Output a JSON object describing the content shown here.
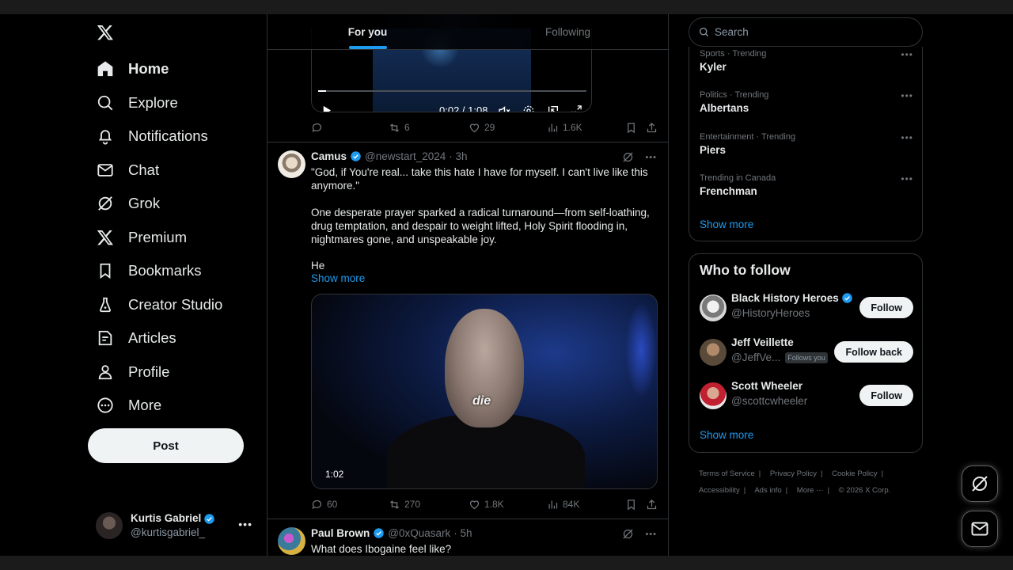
{
  "nav": {
    "items": [
      {
        "label": "Home",
        "icon": "home-icon"
      },
      {
        "label": "Explore",
        "icon": "search-icon"
      },
      {
        "label": "Notifications",
        "icon": "bell-icon"
      },
      {
        "label": "Chat",
        "icon": "mail-icon"
      },
      {
        "label": "Grok",
        "icon": "grok-icon"
      },
      {
        "label": "Premium",
        "icon": "x-icon"
      },
      {
        "label": "Bookmarks",
        "icon": "bookmark-icon"
      },
      {
        "label": "Creator Studio",
        "icon": "flask-icon"
      },
      {
        "label": "Articles",
        "icon": "article-icon"
      },
      {
        "label": "Profile",
        "icon": "person-icon"
      },
      {
        "label": "More",
        "icon": "more-circle-icon"
      }
    ],
    "post_label": "Post",
    "account": {
      "name": "Kurtis Gabriel",
      "handle": "@kurtisgabriel_"
    }
  },
  "tabs": [
    {
      "label": "For you",
      "active": true
    },
    {
      "label": "Following",
      "active": false
    }
  ],
  "video1": {
    "time": "0:02 / 1:08",
    "progress": 0.03
  },
  "post0_actions": {
    "replies": "",
    "reposts": "6",
    "likes": "29",
    "views": "1.6K"
  },
  "post1": {
    "name": "Camus",
    "handle": "@newstart_2024",
    "time": "· 3h",
    "text_p1": "\"God, if You're real... take this hate I have for myself. I can't live like this anymore.\"",
    "text_p2": "One desperate prayer sparked a radical turnaround—from self-loathing, drug temptation, and despair to weight lifted, Holy Spirit flooding in, nightmares gone, and unspeakable joy.",
    "text_p3": "He",
    "show_more": "Show more",
    "video_caption": "die",
    "video_duration": "1:02",
    "actions": {
      "replies": "60",
      "reposts": "270",
      "likes": "1.8K",
      "views": "84K"
    }
  },
  "post2": {
    "name": "Paul Brown",
    "handle": "@0xQuasark",
    "time": "· 5h",
    "text": "What does Ibogaine feel like?"
  },
  "search": {
    "placeholder": "Search"
  },
  "trends": [
    {
      "context": "Sports · Trending",
      "title": "Kyler"
    },
    {
      "context": "Politics · Trending",
      "title": "Albertans"
    },
    {
      "context": "Entertainment · Trending",
      "title": "Piers"
    },
    {
      "context": "Trending in Canada",
      "title": "Frenchman"
    }
  ],
  "trends_show_more": "Show more",
  "who_to_follow": {
    "title": "Who to follow",
    "accounts": [
      {
        "name": "Black History Heroes",
        "handle": "@HistoryHeroes",
        "button": "Follow",
        "verified": true,
        "badge": ""
      },
      {
        "name": "Jeff Veillette",
        "handle": "@JeffVe...",
        "button": "Follow back",
        "verified": false,
        "badge": "Follows you"
      },
      {
        "name": "Scott Wheeler",
        "handle": "@scottcwheeler",
        "button": "Follow",
        "verified": false,
        "badge": ""
      }
    ],
    "show_more": "Show more"
  },
  "footer": {
    "links": [
      "Terms of Service",
      "Privacy Policy",
      "Cookie Policy",
      "Accessibility",
      "Ads info",
      "More ···"
    ],
    "copyright": "© 2026 X Corp."
  },
  "colors": {
    "accent": "#1d9bf0",
    "background": "#000000",
    "border": "#2f3336",
    "muted": "#71767b"
  }
}
